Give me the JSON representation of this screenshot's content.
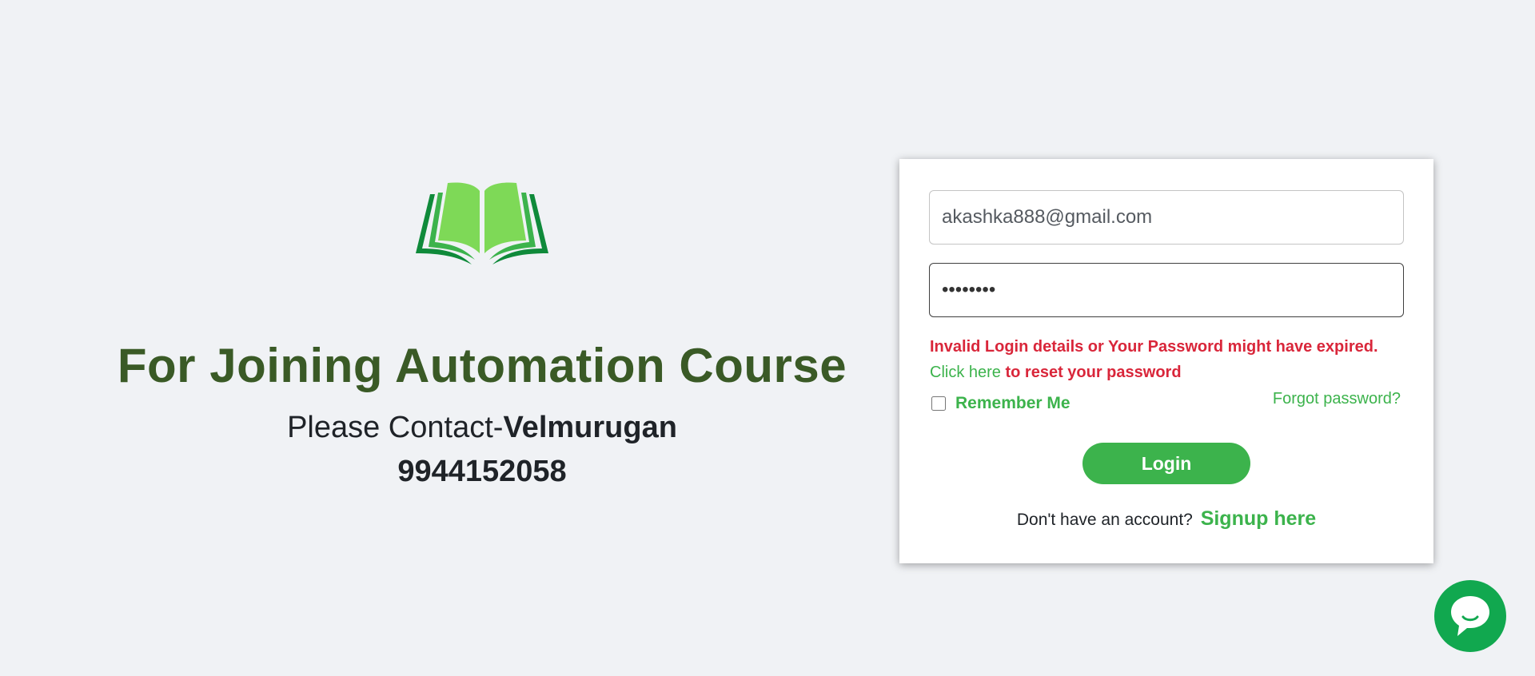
{
  "promo": {
    "title": "For Joining Automation Course",
    "contact_prefix": "Please Contact-",
    "contact_name": "Velmurugan",
    "phone": "9944152058"
  },
  "login": {
    "email_value": "akashka888@gmail.com",
    "password_value": "••••••••",
    "error_message": "Invalid Login details or Your Password might have expired.",
    "click_here_label": "Click here",
    "reset_text": " to reset your password",
    "remember_me_label": "Remember Me",
    "remember_me_checked": false,
    "forgot_password_label": "Forgot password?",
    "login_button_label": "Login",
    "no_account_text": "Don't have an account?",
    "signup_label": "Signup here"
  },
  "icons": {
    "logo": "open-book-icon",
    "chat": "chat-bubble-icon"
  },
  "colors": {
    "background": "#f0f2f5",
    "brand_green": "#3cb34c",
    "title_green": "#3a5a26",
    "error_red": "#d9263a",
    "chat_green": "#11a84f"
  }
}
